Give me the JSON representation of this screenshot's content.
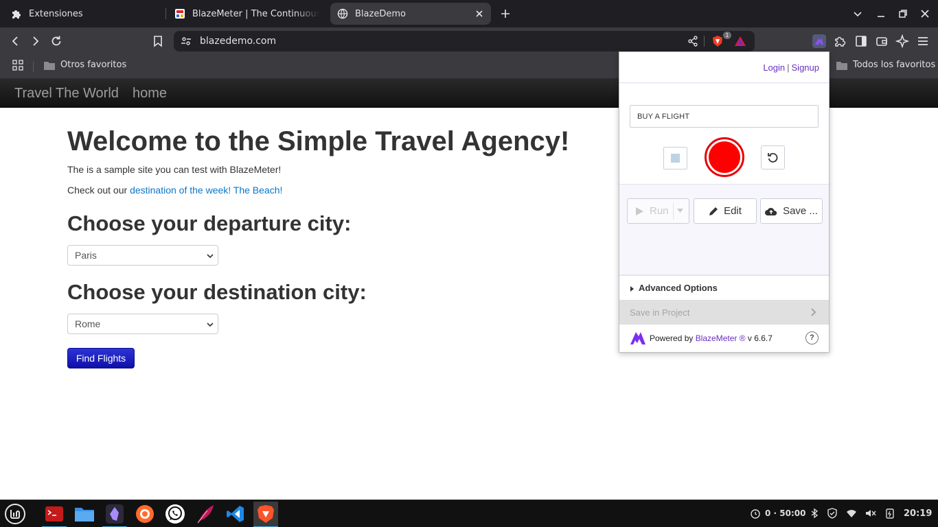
{
  "browser": {
    "tabs": [
      {
        "title": "Extensiones",
        "icon": "puzzle-icon"
      },
      {
        "title": "BlazeMeter | The Continuous Tes",
        "icon": "blazemeter-favicon"
      },
      {
        "title": "BlazeDemo",
        "icon": "globe-icon",
        "active": true
      }
    ],
    "address": "blazedemo.com",
    "shield_badge": "1",
    "bookmarks": {
      "other": "Otros favoritos",
      "all": "Todos los favoritos"
    }
  },
  "page": {
    "brand": "Travel The World",
    "nav_home": "home",
    "heading": "Welcome to the Simple Travel Agency!",
    "intro": "The is a sample site you can test with BlazeMeter!",
    "promo_prefix": "Check out our ",
    "promo_link": "destination of the week! The Beach!",
    "departure_heading": "Choose your departure city:",
    "departure_value": "Paris",
    "destination_heading": "Choose your destination city:",
    "destination_value": "Rome",
    "find_button": "Find Flights"
  },
  "extension": {
    "login": "Login",
    "separator": "|",
    "signup": "Signup",
    "test_name": "BUY A FLIGHT",
    "run_label": "Run",
    "edit_label": "Edit",
    "save_label": "Save ...",
    "advanced_label": "Advanced Options",
    "save_project_label": "Save in Project",
    "powered_by": "Powered by ",
    "brand": "BlazeMeter ®",
    "version": " v 6.6.7",
    "help": "?",
    "colors": {
      "accent": "#6b2fc2",
      "record": "#ff0000"
    }
  },
  "taskbar": {
    "apps": [
      "mint-menu-icon",
      "terminal-icon",
      "files-icon",
      "obsidian-icon",
      "firefox-icon",
      "whatsapp-icon",
      "feather-icon",
      "vscode-icon",
      "brave-icon"
    ],
    "timer": "0 · 50:00",
    "clock": "20:19"
  }
}
